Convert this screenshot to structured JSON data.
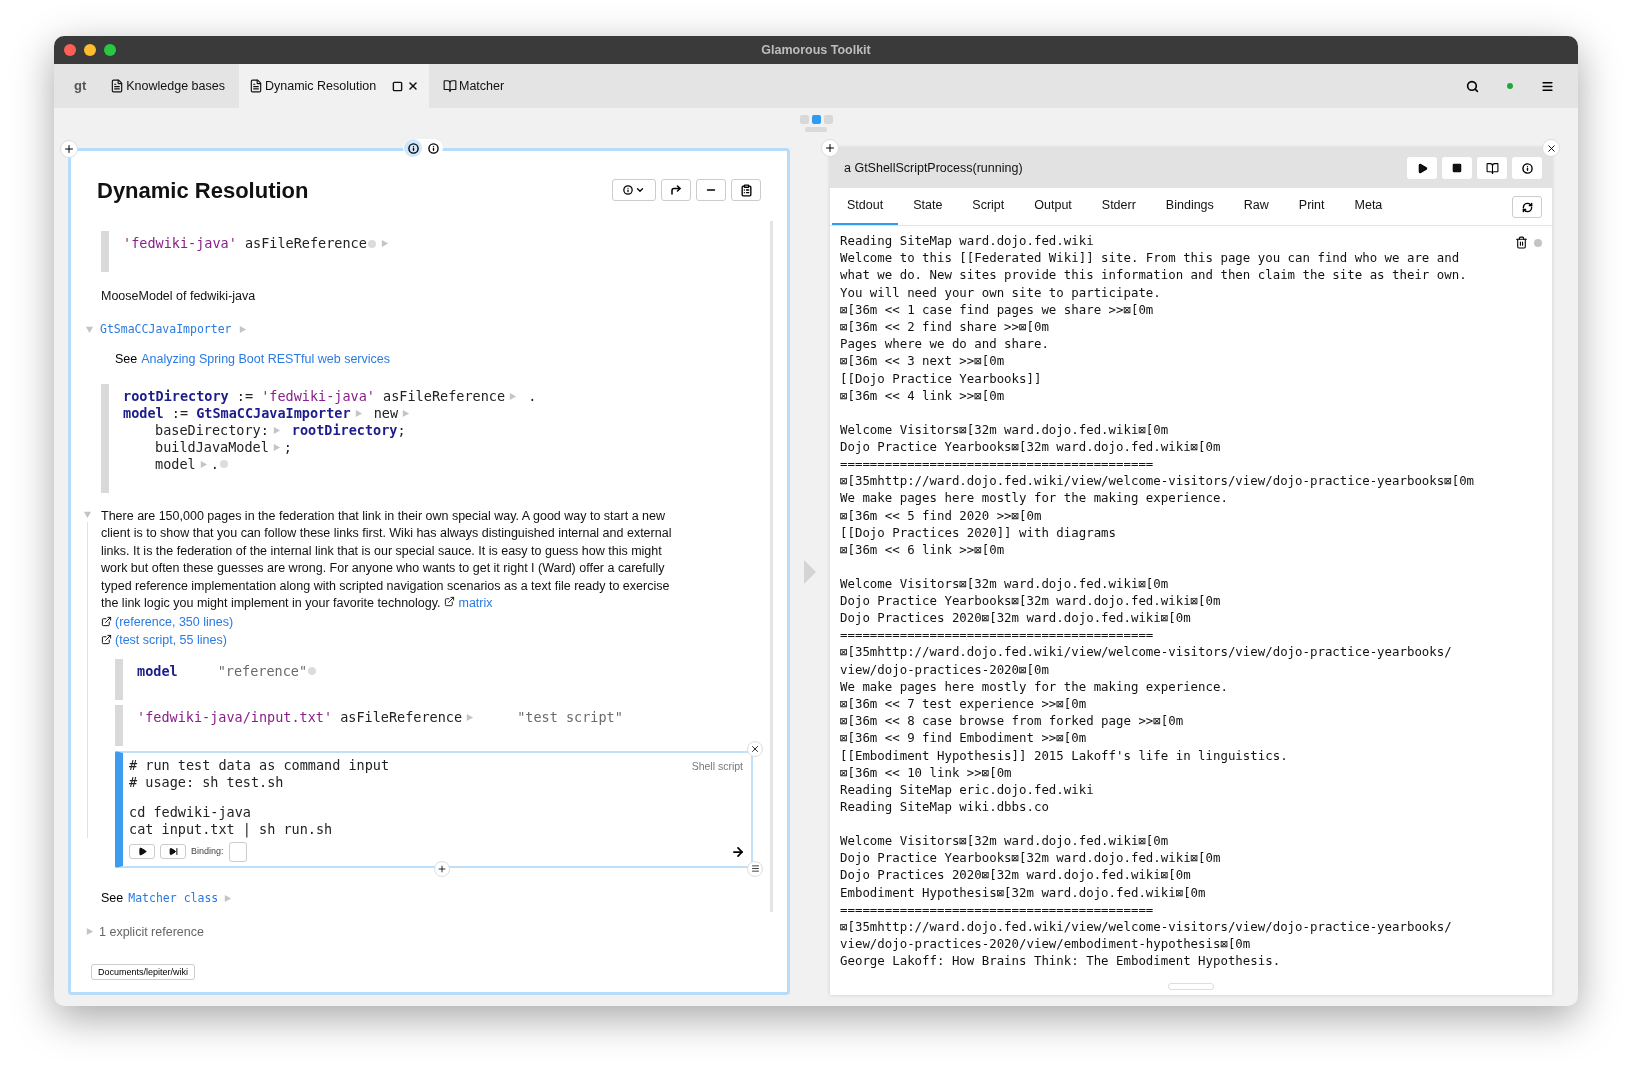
{
  "window": {
    "title": "Glamorous Toolkit"
  },
  "tabs": [
    {
      "kind": "logo",
      "label": "gt",
      "selected": false
    },
    {
      "kind": "page",
      "label": "Knowledge bases",
      "selected": false
    },
    {
      "kind": "page",
      "label": "Dynamic Resolution",
      "selected": true
    },
    {
      "kind": "book",
      "label": "Matcher",
      "selected": false
    }
  ],
  "pager": [
    {
      "selected": false
    },
    {
      "selected": true
    },
    {
      "selected": false
    }
  ],
  "left_pane": {
    "title": "Dynamic Resolution",
    "toggle": [
      {
        "selected": true
      },
      {
        "selected": false
      }
    ],
    "blocks": [
      {
        "kind": "code",
        "lines": [
          [
            {
              "kind": "str",
              "text": "'fedwiki-java'"
            },
            {
              "kind": "plain",
              "text": " asFileReference"
            },
            {
              "kind": "dot"
            },
            {
              "kind": "arrow"
            }
          ]
        ]
      },
      {
        "kind": "text",
        "text": "MooseModel of fedwiki-java"
      },
      {
        "kind": "expander",
        "expanded": true,
        "link": "GtSmaCCJavaImporter",
        "see": "See",
        "see_link": "Analyzing Spring Boot RESTful web services"
      },
      {
        "kind": "code",
        "lines": [
          [
            {
              "kind": "var",
              "text": "rootDirectory"
            },
            {
              "kind": "plain",
              "text": " := "
            },
            {
              "kind": "str",
              "text": "'fedwiki-java'"
            },
            {
              "kind": "plain",
              "text": " asFileReference"
            },
            {
              "kind": "arrow"
            },
            {
              "kind": "plain",
              "text": " ."
            }
          ],
          [
            {
              "kind": "var",
              "text": "model"
            },
            {
              "kind": "plain",
              "text": " := "
            },
            {
              "kind": "var",
              "text": "GtSmaCCJavaImporter"
            },
            {
              "kind": "arrow"
            },
            {
              "kind": "plain",
              "text": " new"
            },
            {
              "kind": "arrow"
            }
          ],
          [
            {
              "kind": "indent"
            },
            {
              "kind": "plain",
              "text": "baseDirectory:"
            },
            {
              "kind": "arrow"
            },
            {
              "kind": "space"
            },
            {
              "kind": "var",
              "text": "rootDirectory"
            },
            {
              "kind": "plain",
              "text": ";"
            }
          ],
          [
            {
              "kind": "indent"
            },
            {
              "kind": "plain",
              "text": "buildJavaModel"
            },
            {
              "kind": "arrow"
            },
            {
              "kind": "plain",
              "text": ";"
            }
          ],
          [
            {
              "kind": "indent"
            },
            {
              "kind": "plain",
              "text": "model"
            },
            {
              "kind": "arrow"
            },
            {
              "kind": "plain",
              "text": "."
            },
            {
              "kind": "dot"
            }
          ]
        ]
      },
      {
        "kind": "paragraph",
        "expanded": true,
        "text": "There are 150,000 pages in the federation that link in their own special way. A good way to start a new client is to show that you can follow these links first. Wiki has always distinguished internal and external links. It is the federation of the internal link that is our special sauce. It is easy to guess how this might work but often these guesses are wrong. For anyone who wants to get it right I (Ward) offer a carefully typed reference implementation along with scripted navigation scenarios as a text file ready to exercise the link logic you might implement in your favorite technology.",
        "link": "matrix",
        "refs": [
          "(reference, 350 lines)",
          "(test script, 55 lines)"
        ],
        "children": [
          {
            "kind": "code",
            "lines": [
              [
                {
                  "kind": "var",
                  "text": "model"
                },
                {
                  "kind": "gap"
                },
                {
                  "kind": "comment",
                  "text": "\"reference\""
                },
                {
                  "kind": "dot"
                }
              ]
            ]
          },
          {
            "kind": "code",
            "lines": [
              [
                {
                  "kind": "str",
                  "text": "'fedwiki-java/input.txt'"
                },
                {
                  "kind": "plain",
                  "text": " asFileReference"
                },
                {
                  "kind": "arrow"
                },
                {
                  "kind": "gap"
                },
                {
                  "kind": "comment",
                  "text": "\"test script\""
                }
              ]
            ]
          },
          {
            "kind": "shell",
            "label": "Shell script",
            "groups": [
              [
                "# run test data as command input",
                "# usage: sh test.sh"
              ],
              [
                "cd fedwiki-java",
                "cat input.txt | sh run.sh"
              ]
            ],
            "binding_label": "Binding:"
          }
        ]
      },
      {
        "kind": "see",
        "text": "See",
        "link": "Matcher class"
      },
      {
        "kind": "reference",
        "expanded": false,
        "text": "1 explicit reference"
      }
    ],
    "footer": "Documents/lepiter/wiki"
  },
  "right_pane": {
    "title": "a GtShellScriptProcess(running)",
    "tabs": [
      {
        "label": "Stdout",
        "selected": true
      },
      {
        "label": "State",
        "selected": false
      },
      {
        "label": "Script",
        "selected": false
      },
      {
        "label": "Output",
        "selected": false
      },
      {
        "label": "Stderr",
        "selected": false
      },
      {
        "label": "Bindings",
        "selected": false
      },
      {
        "label": "Raw",
        "selected": false
      },
      {
        "label": "Print",
        "selected": false
      },
      {
        "label": "Meta",
        "selected": false
      }
    ],
    "stdout": [
      [
        "Reading SiteMap ward.dojo.fed.wiki",
        "Welcome to this [[Federated Wiki]] site. From this page you can find who we are and",
        "what we do. New sites provide this information and then claim the site as their own.",
        "You will need your own site to participate.",
        "⊠[36m << 1 case find pages we share >>⊠[0m",
        "⊠[36m << 2 find share >>⊠[0m",
        "Pages where we do and share.",
        "⊠[36m << 3 next >>⊠[0m",
        "[[Dojo Practice Yearbooks]]",
        "⊠[36m << 4 link >>⊠[0m"
      ],
      [
        "Welcome Visitors⊠[32m ward.dojo.fed.wiki⊠[0m",
        "Dojo Practice Yearbooks⊠[32m ward.dojo.fed.wiki⊠[0m",
        "==========================================",
        "⊠[35mhttp://ward.dojo.fed.wiki/view/welcome-visitors/view/dojo-practice-yearbooks⊠[0m",
        "We make pages here mostly for the making experience.",
        "⊠[36m << 5 find 2020 >>⊠[0m",
        "[[Dojo Practices 2020]] with diagrams",
        "⊠[36m << 6 link >>⊠[0m"
      ],
      [
        "Welcome Visitors⊠[32m ward.dojo.fed.wiki⊠[0m",
        "Dojo Practice Yearbooks⊠[32m ward.dojo.fed.wiki⊠[0m",
        "Dojo Practices 2020⊠[32m ward.dojo.fed.wiki⊠[0m",
        "==========================================",
        "⊠[35mhttp://ward.dojo.fed.wiki/view/welcome-visitors/view/dojo-practice-yearbooks/",
        "view/dojo-practices-2020⊠[0m",
        "We make pages here mostly for the making experience.",
        "⊠[36m << 7 test experience >>⊠[0m",
        "⊠[36m << 8 case browse from forked page >>⊠[0m",
        "⊠[36m << 9 find Embodiment >>⊠[0m",
        "[[Embodiment Hypothesis]] 2015 Lakoff's life in linguistics.",
        "⊠[36m << 10 link >>⊠[0m",
        "Reading SiteMap eric.dojo.fed.wiki",
        "Reading SiteMap wiki.dbbs.co"
      ],
      [
        "Welcome Visitors⊠[32m ward.dojo.fed.wiki⊠[0m",
        "Dojo Practice Yearbooks⊠[32m ward.dojo.fed.wiki⊠[0m",
        "Dojo Practices 2020⊠[32m ward.dojo.fed.wiki⊠[0m",
        "Embodiment Hypothesis⊠[32m ward.dojo.fed.wiki⊠[0m",
        "==========================================",
        "⊠[35mhttp://ward.dojo.fed.wiki/view/welcome-visitors/view/dojo-practice-yearbooks/",
        "view/dojo-practices-2020/view/embodiment-hypothesis⊠[0m",
        "George Lakoff: How Brains Think: The Embodiment Hypothesis."
      ]
    ]
  }
}
